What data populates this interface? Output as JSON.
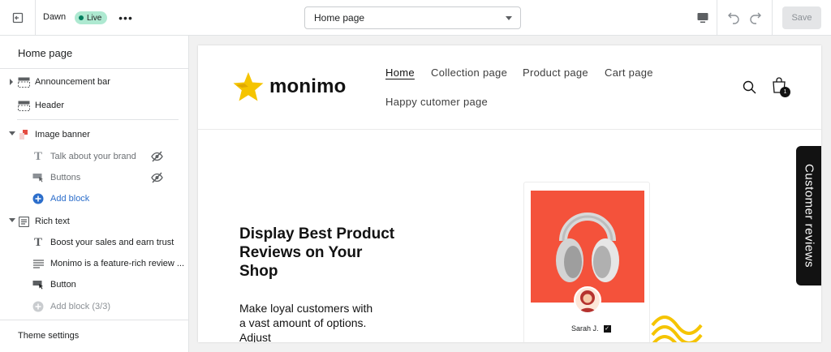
{
  "topbar": {
    "theme_name": "Dawn",
    "status_badge": "Live",
    "more_label": "•••",
    "page_selector_value": "Home page",
    "save_label": "Save"
  },
  "sidebar": {
    "title": "Home page",
    "sections": [
      {
        "label": "Announcement bar"
      },
      {
        "label": "Header"
      },
      {
        "label": "Image banner"
      },
      {
        "label": "Rich text"
      }
    ],
    "image_banner_blocks": [
      {
        "label": "Talk about your brand"
      },
      {
        "label": "Buttons"
      },
      {
        "label": "Add block"
      }
    ],
    "rich_text_blocks": [
      {
        "label": "Boost your sales and earn trust"
      },
      {
        "label": "Monimo is a feature-rich review ..."
      },
      {
        "label": "Button"
      },
      {
        "label": "Add block (3/3)"
      }
    ],
    "theme_settings": "Theme settings"
  },
  "preview": {
    "logo_text": "monimo",
    "logo_color": "#f5c400",
    "nav": [
      "Home",
      "Collection page",
      "Product page",
      "Cart page",
      "Happy cutomer page"
    ],
    "cart_count": "1",
    "banner_heading": "Display Best Product Reviews on Your Shop",
    "banner_text": "Make loyal customers with a vast amount of options. Adjust",
    "reviewer_name": "Sarah J.",
    "side_tab": "Customer reviews",
    "product_bg": "#f4523b"
  },
  "colors": {
    "live_badge": "#aee9d1",
    "accent_link": "#2c6ecb"
  }
}
